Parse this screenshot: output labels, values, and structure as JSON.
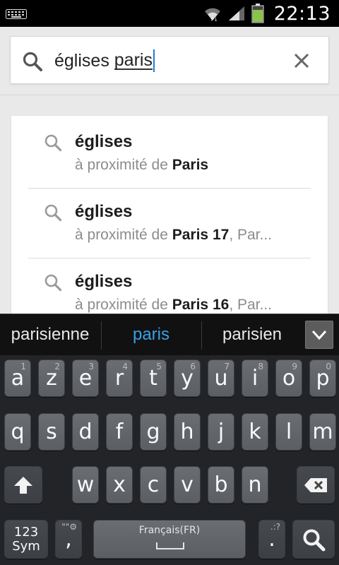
{
  "status_bar": {
    "time": "22:13",
    "icons": [
      "keyboard-icon",
      "wifi-icon",
      "signal-icon",
      "battery-icon"
    ],
    "battery_color": "#8bc34a"
  },
  "search": {
    "query_part1": "églises ",
    "query_part2": "paris",
    "icon": "search-icon",
    "clear_icon": "close-icon"
  },
  "suggestions": [
    {
      "title": "églises",
      "prefix": "à proximité de ",
      "place": "Paris",
      "suffix": ""
    },
    {
      "title": "églises",
      "prefix": "à proximité de ",
      "place": "Paris 17",
      "suffix": ", Par..."
    },
    {
      "title": "églises",
      "prefix": "à proximité de ",
      "place": "Paris 16",
      "suffix": ", Par..."
    }
  ],
  "candidates": {
    "left": "parisienne",
    "center": "paris",
    "right": "parisien",
    "accent": "#3aa0e8"
  },
  "keyboard": {
    "row1": [
      {
        "k": "a",
        "h": "1"
      },
      {
        "k": "z",
        "h": "2"
      },
      {
        "k": "e",
        "h": "3"
      },
      {
        "k": "r",
        "h": "4"
      },
      {
        "k": "t",
        "h": "5"
      },
      {
        "k": "y",
        "h": "6"
      },
      {
        "k": "u",
        "h": "7"
      },
      {
        "k": "i",
        "h": "8"
      },
      {
        "k": "o",
        "h": "9"
      },
      {
        "k": "p",
        "h": "0"
      }
    ],
    "row2": [
      "q",
      "s",
      "d",
      "f",
      "g",
      "h",
      "j",
      "k",
      "l",
      "m"
    ],
    "row3": [
      "w",
      "x",
      "c",
      "v",
      "b",
      "n"
    ],
    "sym_label_1": "123",
    "sym_label_2": "Sym",
    "comma": ",",
    "comma_hint": "\"\"⚙",
    "space_label": "Français(FR)",
    "period": ".",
    "period_hint": ".:?"
  }
}
